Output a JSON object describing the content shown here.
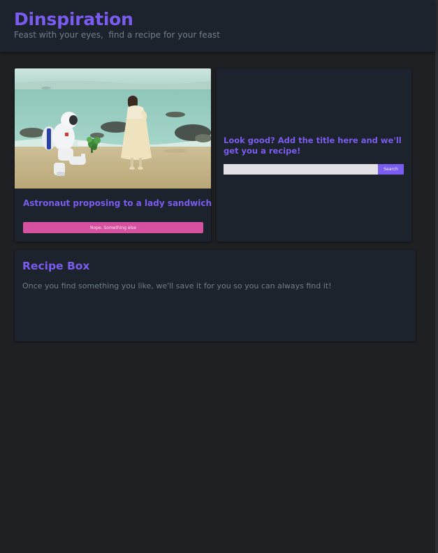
{
  "header": {
    "title": "Dinspiration",
    "tagline": "Feast with your eyes,  find a recipe for your feast"
  },
  "featured": {
    "image_alt": "Astronaut proposing to a lady sandwich",
    "recipe_title": "Astronaut proposing to a lady sandwich",
    "skip_button_label": "Nope. Something else"
  },
  "search": {
    "prompt": "Look good? Add the title here and we'll get you a recipe!",
    "input_value": "",
    "input_placeholder": "",
    "button_label": "Search"
  },
  "recipe_box": {
    "title": "Recipe Box",
    "description": "Once you find something you like, we'll save it for you so you can always find it!"
  },
  "colors": {
    "background": "#1f2024",
    "card": "#1d232c",
    "accent_purple": "#7b5cf0",
    "accent_pink": "#d6519f",
    "muted_text": "#6f7d8c"
  }
}
